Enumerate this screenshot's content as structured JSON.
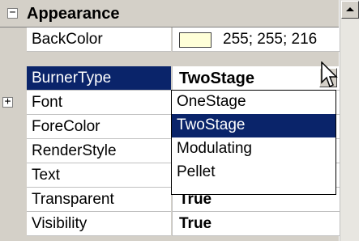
{
  "category": {
    "expand_glyph": "⊟",
    "title": "Appearance"
  },
  "rows": [
    {
      "name": "BackColor",
      "value": "255; 255; 216",
      "swatch_color": "#ffffd8"
    },
    {
      "name": "BurnerType",
      "value": "TwoStage",
      "selected": true
    },
    {
      "name": "Font",
      "value": "",
      "expand_glyph": "⊞"
    },
    {
      "name": "ForeColor",
      "value": ""
    },
    {
      "name": "RenderStyle",
      "value": ""
    },
    {
      "name": "Text",
      "value": ""
    },
    {
      "name": "Transparent",
      "value": "True"
    },
    {
      "name": "Visibility",
      "value": "True"
    }
  ],
  "dropdown": {
    "options": [
      "OneStage",
      "TwoStage",
      "Modulating",
      "Pellet"
    ],
    "selected": "TwoStage"
  },
  "colors": {
    "selection": "#0a246a",
    "panel": "#d4d0c8"
  }
}
